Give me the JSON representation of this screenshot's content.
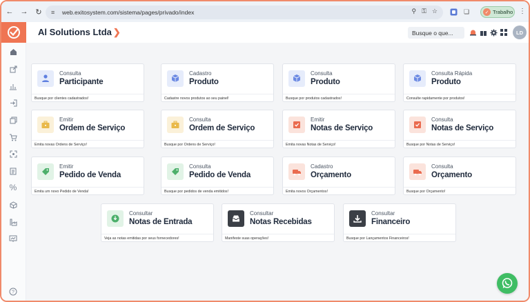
{
  "browser": {
    "url": "web.exitosystem.com/sistema/pages/privado/index",
    "profile_label": "Trabalho"
  },
  "header": {
    "company": "Al Solutions Ltda",
    "search_placeholder": "Busque o que...",
    "avatar_initials": "LD"
  },
  "colors": {
    "accent": "#ef7553",
    "whatsapp": "#3fbd64",
    "blue_icon": "#5e7fe0",
    "yellow_icon": "#e9b949",
    "green_icon": "#4caf6a",
    "red_icon": "#ea6b4f",
    "dark_icon": "#3b3f46"
  },
  "cards": [
    {
      "sub": "Consulta",
      "title": "Participante",
      "desc": "Busque por clientes cadastrados!",
      "icon": "user-icon",
      "tone": "blue"
    },
    {
      "sub": "Cadastro",
      "title": "Produto",
      "desc": "Cadastre novos produtos ao seu painel!",
      "icon": "box-icon",
      "tone": "blue"
    },
    {
      "sub": "Consulta",
      "title": "Produto",
      "desc": "Busque por produtos cadastrados!",
      "icon": "box-icon",
      "tone": "blue"
    },
    {
      "sub": "Consulta Rápida",
      "title": "Produto",
      "desc": "Consulte rapidamente por produtos!",
      "icon": "box-icon",
      "tone": "blue"
    },
    {
      "sub": "Emitir",
      "title": "Ordem de Serviço",
      "desc": "Emita novas Ordens de Serviço!",
      "icon": "briefcase-icon",
      "tone": "yellow"
    },
    {
      "sub": "Consulta",
      "title": "Ordem de Serviço",
      "desc": "Busque por Ordens de Serviço!",
      "icon": "briefcase-icon",
      "tone": "yellow"
    },
    {
      "sub": "Emitir",
      "title": "Notas de Serviço",
      "desc": "Emita novas Notas de Serviço!",
      "icon": "receipt-icon",
      "tone": "red"
    },
    {
      "sub": "Consulta",
      "title": "Notas de Serviço",
      "desc": "Busque por Notas de Serviço!",
      "icon": "receipt-icon",
      "tone": "red"
    },
    {
      "sub": "Emitir",
      "title": "Pedido de Venda",
      "desc": "Emita um novo Pedido de Venda!",
      "icon": "tag-icon",
      "tone": "green"
    },
    {
      "sub": "Consulta",
      "title": "Pedido de Venda",
      "desc": "Busque por pedidos de venda emitidos!",
      "icon": "tag-icon",
      "tone": "green"
    },
    {
      "sub": "Cadastro",
      "title": "Orçamento",
      "desc": "Emita novos Orçamentos!",
      "icon": "truck-icon",
      "tone": "red"
    },
    {
      "sub": "Consulta",
      "title": "Orçamento",
      "desc": "Busque por Orçamento!",
      "icon": "truck-icon",
      "tone": "red"
    },
    {
      "sub": "Consultar",
      "title": "Notas de Entrada",
      "desc": "Veja as notas emitidas por seus fornecedores!",
      "icon": "invoice-in-icon",
      "tone": "green"
    },
    {
      "sub": "Consultar",
      "title": "Notas Recebidas",
      "desc": "Manifeste suas operações!",
      "icon": "inbox-icon",
      "tone": "dark"
    },
    {
      "sub": "Consultar",
      "title": "Financeiro",
      "desc": "Busque por Lançamentos Financeiros!",
      "icon": "download-icon",
      "tone": "dark"
    }
  ]
}
